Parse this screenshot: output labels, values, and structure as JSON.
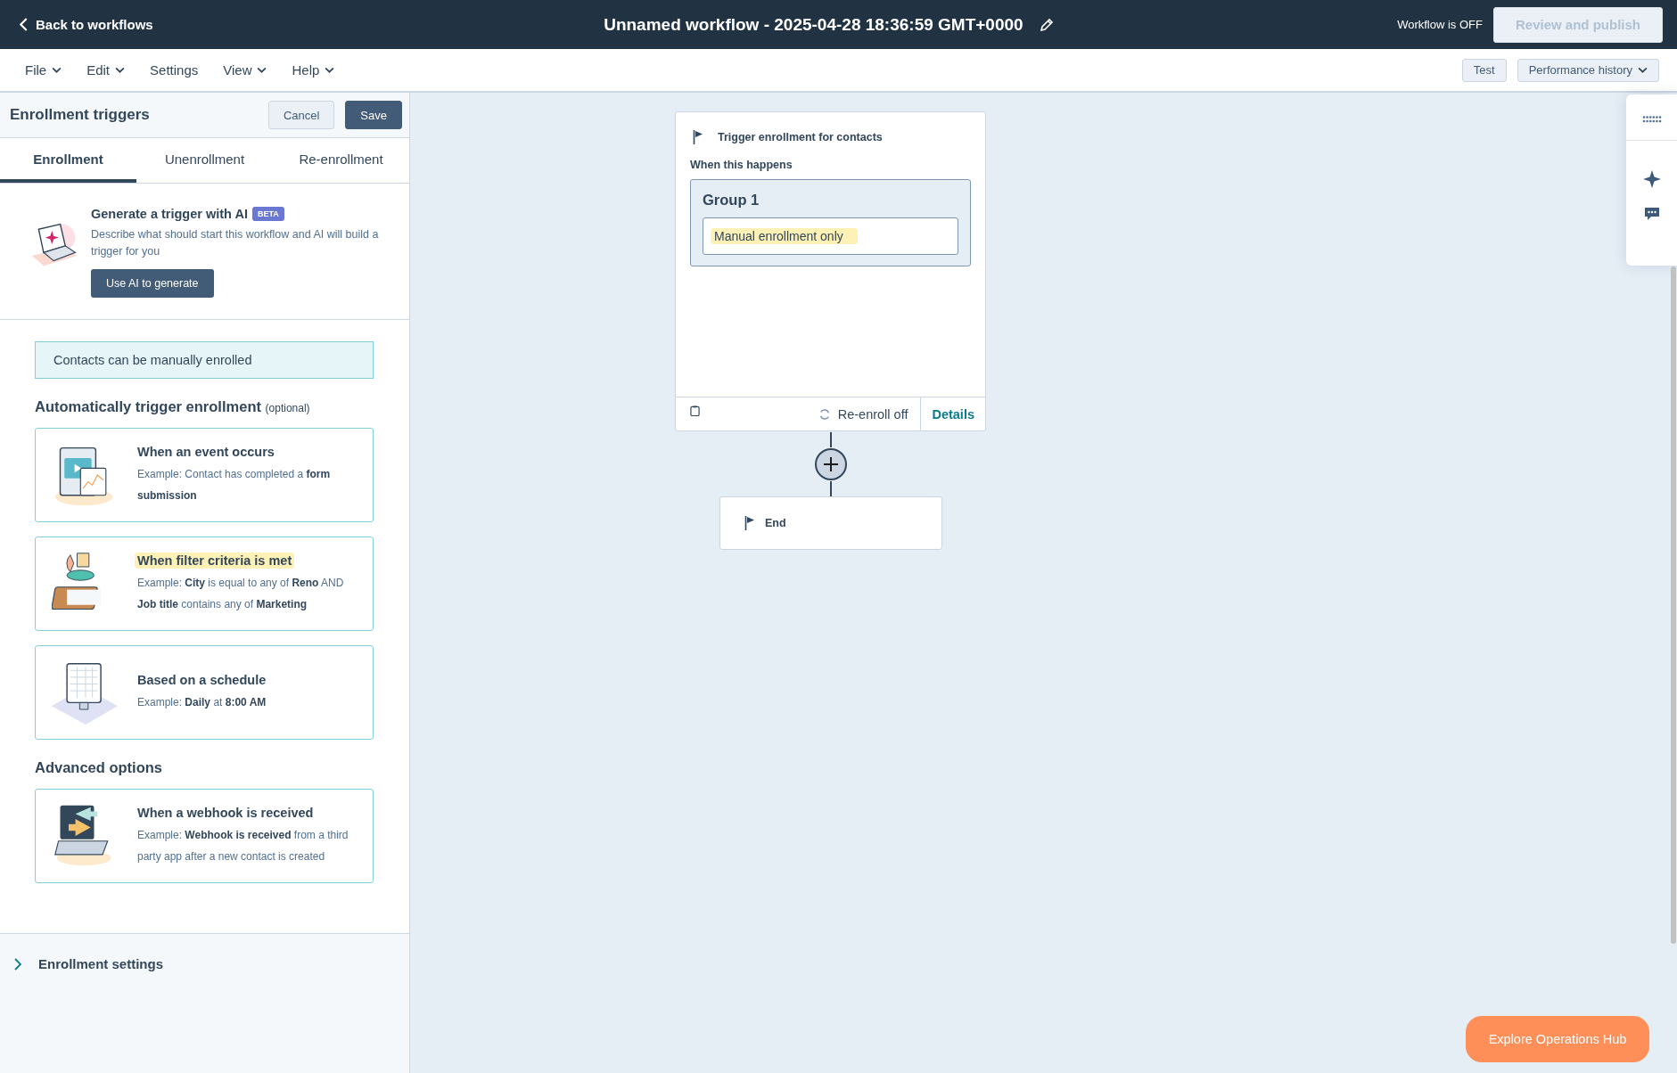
{
  "top_bar": {
    "back_link": "Back to workflows",
    "title": "Unnamed workflow - 2025-04-28 18:36:59 GMT+0000",
    "status": "Workflow is OFF",
    "publish_button": {
      "label": "Review and publish",
      "disabled": true
    }
  },
  "menu_bar": {
    "items": [
      {
        "label": "File",
        "dropdown": true
      },
      {
        "label": "Edit",
        "dropdown": true
      },
      {
        "label": "Settings",
        "dropdown": false
      },
      {
        "label": "View",
        "dropdown": true
      },
      {
        "label": "Help",
        "dropdown": true
      }
    ],
    "buttons": [
      {
        "label": "Test",
        "dropdown": false
      },
      {
        "label": "Performance history",
        "dropdown": true
      }
    ]
  },
  "panel": {
    "title": "Enrollment triggers",
    "cancel": "Cancel",
    "save": "Save",
    "tabs": [
      {
        "label": "Enrollment",
        "selected": true
      },
      {
        "label": "Unenrollment",
        "selected": false
      },
      {
        "label": "Re-enrollment",
        "selected": false
      }
    ],
    "ai": {
      "title": "Generate a trigger with AI",
      "badge": "BETA",
      "description": "Describe what should start this workflow and AI will build a trigger for you",
      "button": "Use AI to generate"
    },
    "notice": "Contacts can be manually enrolled",
    "auto_heading": "Automatically trigger enrollment",
    "auto_note": "(optional)",
    "auto_options": [
      {
        "kind": "event",
        "title": "When an event occurs",
        "highlighted": false,
        "example": "Example: Contact has completed a **form submission**"
      },
      {
        "kind": "filter",
        "title": "When filter criteria is met",
        "highlighted": true,
        "example": "Example: **City** is equal to any of **Reno** AND **Job title** contains any of **Marketing**"
      },
      {
        "kind": "schedule",
        "title": "Based on a schedule",
        "highlighted": false,
        "example": "Example: **Daily** at **8:00 AM**"
      }
    ],
    "advanced_heading": "Advanced options",
    "advanced_options": [
      {
        "kind": "webhook",
        "title": "When a webhook is received",
        "highlighted": false,
        "example": "Example: **Webhook is received** from a third party app after a new contact is created"
      }
    ],
    "settings": {
      "label": "Enrollment settings",
      "expanded": false
    }
  },
  "canvas": {
    "trigger": {
      "title": "Trigger enrollment for contacts",
      "subtitle": "When this happens",
      "group": "Group 1",
      "criteria": "Manual enrollment only",
      "reenroll": "Re-enroll off",
      "details": "Details"
    },
    "end": "End"
  },
  "promo_button": "Explore Operations Hub"
}
